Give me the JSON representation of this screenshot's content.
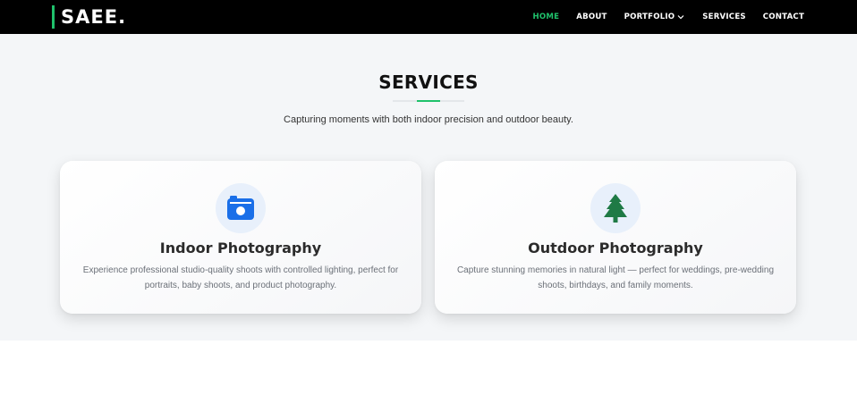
{
  "brand": {
    "logo_text": "SAEE.",
    "accent": "#1fc16b"
  },
  "nav": {
    "items": [
      {
        "label": "HOME",
        "active": true
      },
      {
        "label": "ABOUT",
        "active": false
      },
      {
        "label": "PORTFOLIO",
        "active": false,
        "dropdown": true
      },
      {
        "label": "SERVICES",
        "active": false
      },
      {
        "label": "CONTACT",
        "active": false
      }
    ]
  },
  "services": {
    "title": "SERVICES",
    "subtitle": "Capturing moments with both indoor precision and outdoor beauty.",
    "cards": [
      {
        "icon": "camera-icon",
        "icon_color": "#1a6fe8",
        "title": "Indoor Photography",
        "description": "Experience professional studio-quality shoots with controlled lighting, perfect for portraits, baby shoots, and product photography."
      },
      {
        "icon": "tree-icon",
        "icon_color": "#1f7a45",
        "title": "Outdoor Photography",
        "description": "Capture stunning memories in natural light — perfect for weddings, pre-wedding shoots, birthdays, and family moments."
      }
    ]
  }
}
